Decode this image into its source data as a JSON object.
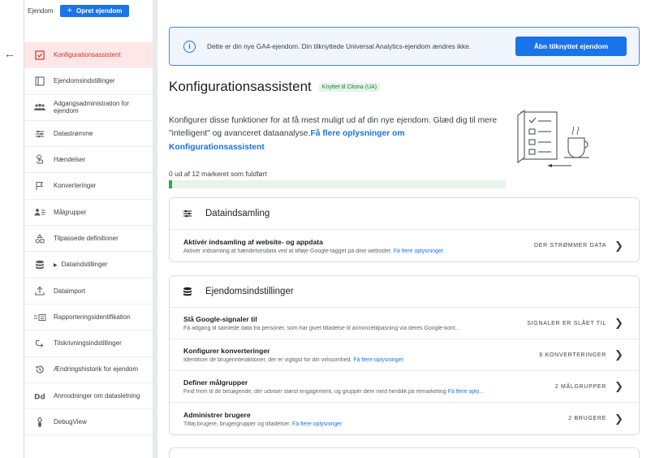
{
  "sidebar": {
    "property_label": "Ejendom",
    "create_button": "Opret ejendom",
    "items": [
      {
        "icon": "checklist-icon",
        "label": "Konfigurationsassistent",
        "active": true
      },
      {
        "icon": "settings-panel-icon",
        "label": "Ejendomsindstillinger"
      },
      {
        "icon": "people-icon",
        "label": "Adgangsadministration for ejendom"
      },
      {
        "icon": "data-streams-icon",
        "label": "Datastrømme"
      },
      {
        "icon": "touch-icon",
        "label": "Hændelser"
      },
      {
        "icon": "flag-icon",
        "label": "Konverteringer"
      },
      {
        "icon": "audience-icon",
        "label": "Målgrupper"
      },
      {
        "icon": "shapes-icon",
        "label": "Tilpassede definitioner"
      },
      {
        "icon": "database-icon",
        "label": "Dataindstillinger"
      },
      {
        "icon": "upload-icon",
        "label": "Dataimport"
      },
      {
        "icon": "report-id-icon",
        "label": "Rapporteringsidentifikation"
      },
      {
        "icon": "attribution-icon",
        "label": "Tilskrivningsindstillinger"
      },
      {
        "icon": "history-icon",
        "label": "Ændringshistorik for ejendom"
      },
      {
        "icon": "dd-icon",
        "label": "Anmodninger om datasletning"
      },
      {
        "icon": "debug-icon",
        "label": "DebugView"
      }
    ]
  },
  "banner": {
    "text": "Dette er din nye GA4-ejendom. Din tilknyttede Universal Analytics-ejendom ændres ikke.",
    "button": "Åbn tilknyttet ejendom"
  },
  "page": {
    "title": "Konfigurationsassistent",
    "badge": "Knyttet til Citona (UA)",
    "intro": "Konfigurer disse funktioner for at få mest muligt ud af din nye ejendom. Glæd dig til mere \"intelligent\" og avanceret dataanalyse.",
    "intro_link": "Få flere oplysninger om Konfigurationsassistent",
    "progress_text": "0 ud af 12 markeret som fuldført",
    "progress_fraction": 0.01
  },
  "cards": [
    {
      "title": "Dataindsamling",
      "icon": "data-streams-icon",
      "rows": [
        {
          "title": "Aktivér indsamling af website- og appdata",
          "desc": "Aktivér indsamling af hændelsesdata ved at tilføje Google-tagget på dine websider.",
          "link": "Få flere oplysninger",
          "status": "DER STRØMMER DATA"
        }
      ]
    },
    {
      "title": "Ejendomsindstillinger",
      "icon": "database-icon",
      "rows": [
        {
          "title": "Slå Google-signaler til",
          "desc": "Få adgang til samlede data fra personer, som har givet tilladelse til annoncetilpasning via deres Google-kont...",
          "link": "",
          "status": "SIGNALER ER SLÅET TIL"
        },
        {
          "title": "Konfigurer konverteringer",
          "desc": "Identificer de brugerinteraktioner, der er vigtigst for din virksomhed.",
          "link": "Få flere oplysninger",
          "status": "6 KONVERTERINGER"
        },
        {
          "title": "Definer målgrupper",
          "desc": "Find frem til de besøgende, der udviser størst engagement, og gruppér dem med henblik på remarketing",
          "link": "Få flere oply...",
          "status": "2 MÅLGRUPPER"
        },
        {
          "title": "Administrer brugere",
          "desc": "Tilføj brugere, brugergrupper og tilladelser.",
          "link": "Få flere oplysninger",
          "status": "2 BRUGERE"
        }
      ]
    }
  ]
}
